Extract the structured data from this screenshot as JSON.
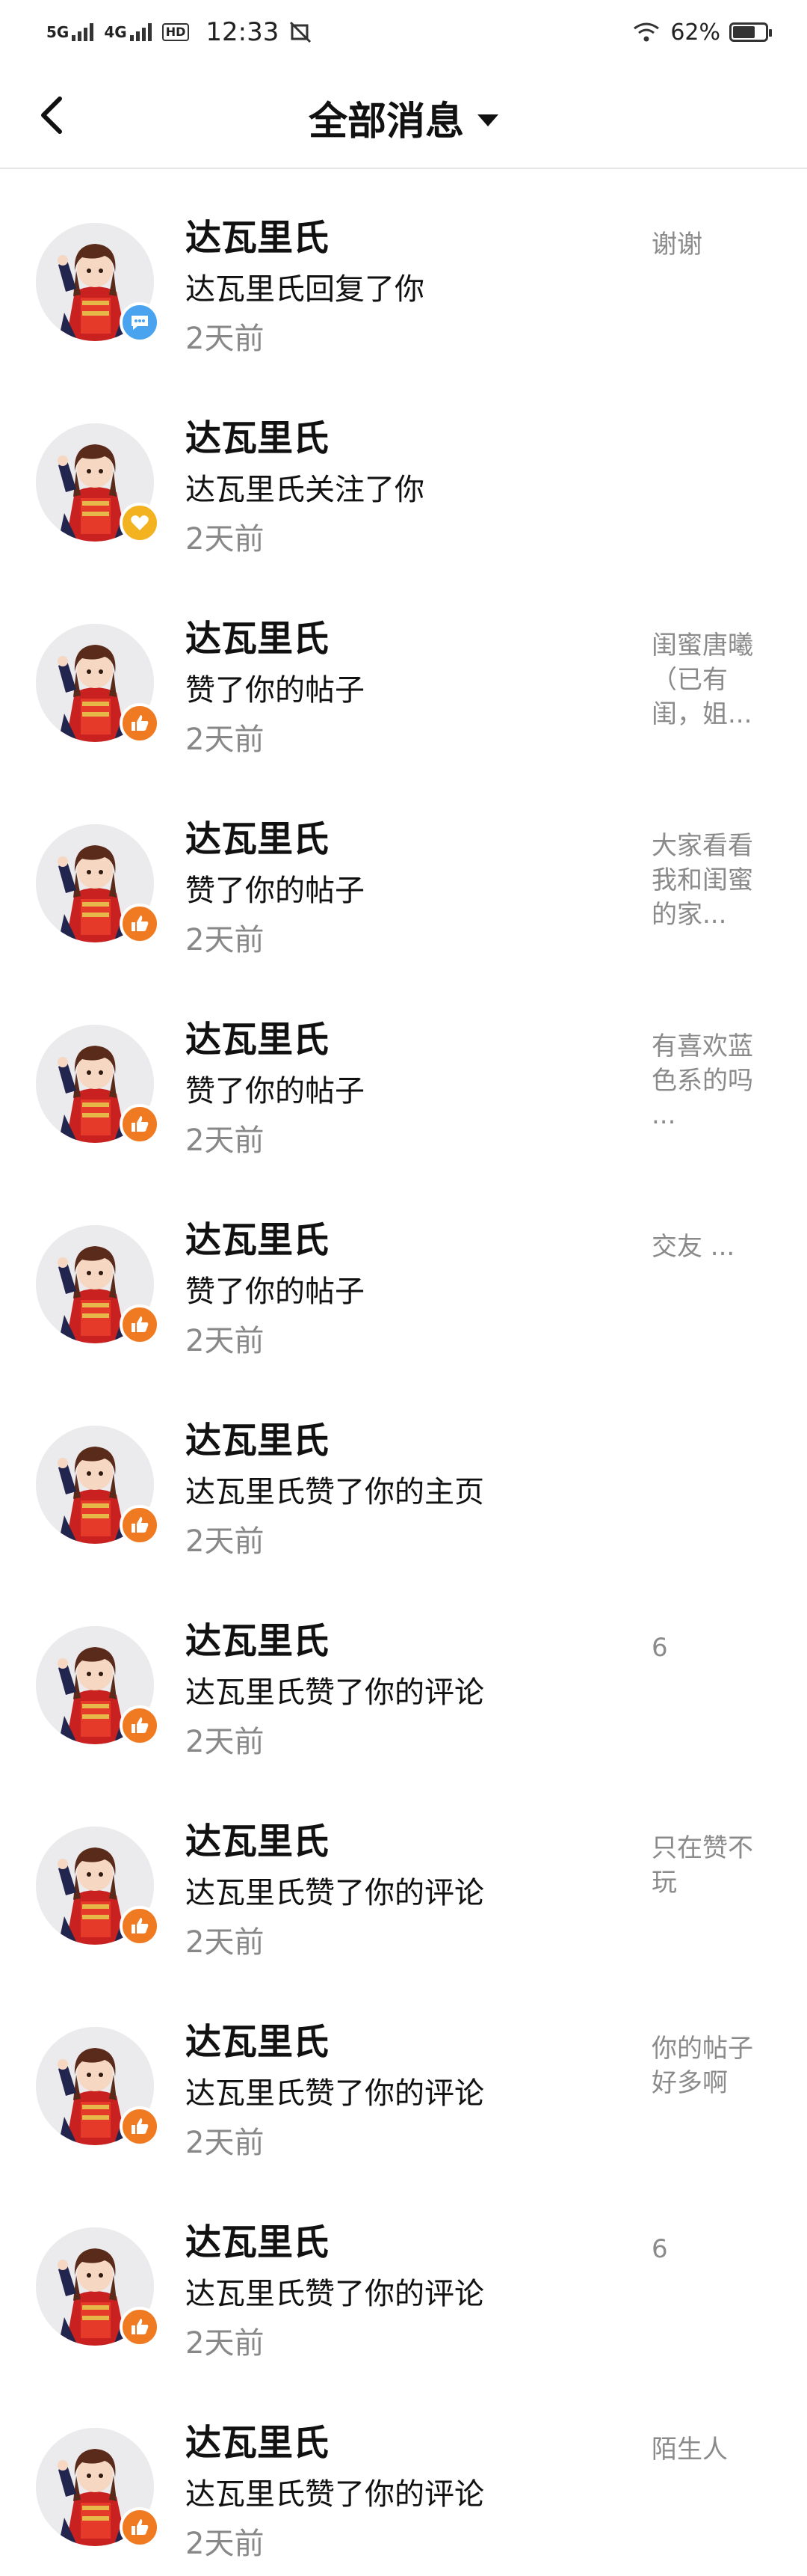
{
  "status_bar": {
    "net1": "5G",
    "net2": "4G",
    "hd": "HD",
    "time": "12:33",
    "battery_text": "62%",
    "battery_level": 0.62
  },
  "header": {
    "title": "全部消息"
  },
  "colors": {
    "reply_badge": "#4aa3ee",
    "follow_badge": "#f3b21f",
    "like_badge": "#f07a22",
    "secondary_text": "#888888"
  },
  "messages": [
    {
      "name": "达瓦里氏",
      "action": "达瓦里氏回复了你",
      "time": "2天前",
      "snippet": "谢谢",
      "badge": "reply"
    },
    {
      "name": "达瓦里氏",
      "action": "达瓦里氏关注了你",
      "time": "2天前",
      "snippet": "",
      "badge": "follow"
    },
    {
      "name": "达瓦里氏",
      "action": "赞了你的帖子",
      "time": "2天前",
      "snippet": "闺蜜唐曦（已有闺，姐...",
      "badge": "like"
    },
    {
      "name": "达瓦里氏",
      "action": "赞了你的帖子",
      "time": "2天前",
      "snippet": "大家看看我和闺蜜的家...",
      "badge": "like"
    },
    {
      "name": "达瓦里氏",
      "action": "赞了你的帖子",
      "time": "2天前",
      "snippet": "有喜欢蓝色系的吗 ...",
      "badge": "like"
    },
    {
      "name": "达瓦里氏",
      "action": "赞了你的帖子",
      "time": "2天前",
      "snippet": "交友 ...",
      "badge": "like"
    },
    {
      "name": "达瓦里氏",
      "action": "达瓦里氏赞了你的主页",
      "time": "2天前",
      "snippet": "",
      "badge": "like"
    },
    {
      "name": "达瓦里氏",
      "action": "达瓦里氏赞了你的评论",
      "time": "2天前",
      "snippet": "6",
      "badge": "like"
    },
    {
      "name": "达瓦里氏",
      "action": "达瓦里氏赞了你的评论",
      "time": "2天前",
      "snippet": "只在赞不玩",
      "badge": "like"
    },
    {
      "name": "达瓦里氏",
      "action": "达瓦里氏赞了你的评论",
      "time": "2天前",
      "snippet": "你的帖子好多啊",
      "badge": "like"
    },
    {
      "name": "达瓦里氏",
      "action": "达瓦里氏赞了你的评论",
      "time": "2天前",
      "snippet": "6",
      "badge": "like"
    },
    {
      "name": "达瓦里氏",
      "action": "达瓦里氏赞了你的评论",
      "time": "2天前",
      "snippet": "陌生人",
      "badge": "like"
    }
  ]
}
